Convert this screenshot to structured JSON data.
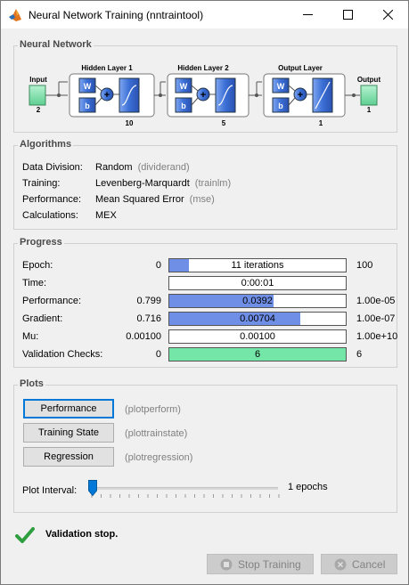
{
  "window": {
    "title": "Neural Network Training (nntraintool)"
  },
  "network": {
    "section_title": "Neural Network",
    "input_label": "Input",
    "input_size": "2",
    "output_label": "Output",
    "output_size": "1",
    "layers": [
      {
        "title": "Hidden Layer 1",
        "size": "10",
        "w": "W",
        "b": "b",
        "transfer": "tansig"
      },
      {
        "title": "Hidden Layer 2",
        "size": "5",
        "w": "W",
        "b": "b",
        "transfer": "tansig"
      },
      {
        "title": "Output Layer",
        "size": "1",
        "w": "W",
        "b": "b",
        "transfer": "purelin"
      }
    ]
  },
  "algorithms": {
    "section_title": "Algorithms",
    "rows": [
      {
        "label": "Data Division:",
        "value": "Random",
        "func": "(dividerand)"
      },
      {
        "label": "Training:",
        "value": "Levenberg-Marquardt",
        "func": "(trainlm)"
      },
      {
        "label": "Performance:",
        "value": "Mean Squared Error",
        "func": "(mse)"
      },
      {
        "label": "Calculations:",
        "value": "MEX",
        "func": ""
      }
    ]
  },
  "progress": {
    "section_title": "Progress",
    "rows": [
      {
        "label": "Epoch:",
        "start": "0",
        "current": "11 iterations",
        "end": "100",
        "fill": 0.11,
        "color": "#6f8ee6"
      },
      {
        "label": "Time:",
        "start": "",
        "current": "0:00:01",
        "end": "",
        "fill": 0,
        "color": "#6f8ee6"
      },
      {
        "label": "Performance:",
        "start": "0.799",
        "current": "0.0392",
        "end": "1.00e-05",
        "fill": 0.59,
        "color": "#6f8ee6"
      },
      {
        "label": "Gradient:",
        "start": "0.716",
        "current": "0.00704",
        "end": "1.00e-07",
        "fill": 0.74,
        "color": "#6f8ee6"
      },
      {
        "label": "Mu:",
        "start": "0.00100",
        "current": "0.00100",
        "end": "1.00e+10",
        "fill": 0,
        "color": "#6f8ee6"
      },
      {
        "label": "Validation Checks:",
        "start": "0",
        "current": "6",
        "end": "6",
        "fill": 1.0,
        "color": "#73e6a8"
      }
    ]
  },
  "plots": {
    "section_title": "Plots",
    "buttons": [
      {
        "label": "Performance",
        "hint": "(plotperform)"
      },
      {
        "label": "Training State",
        "hint": "(plottrainstate)"
      },
      {
        "label": "Regression",
        "hint": "(plotregression)"
      }
    ],
    "interval_label": "Plot Interval:",
    "interval_value": "1 epochs",
    "interval_position": 0
  },
  "status": {
    "text": "Validation stop.",
    "icon": "check-icon"
  },
  "actions": {
    "stop_label": "Stop Training",
    "cancel_label": "Cancel"
  },
  "colors": {
    "accent": "#0078d7",
    "bar_blue": "#6f8ee6",
    "bar_green": "#73e6a8",
    "io_green": "#8ee8b4",
    "block_blue": "#3b6fd6"
  }
}
